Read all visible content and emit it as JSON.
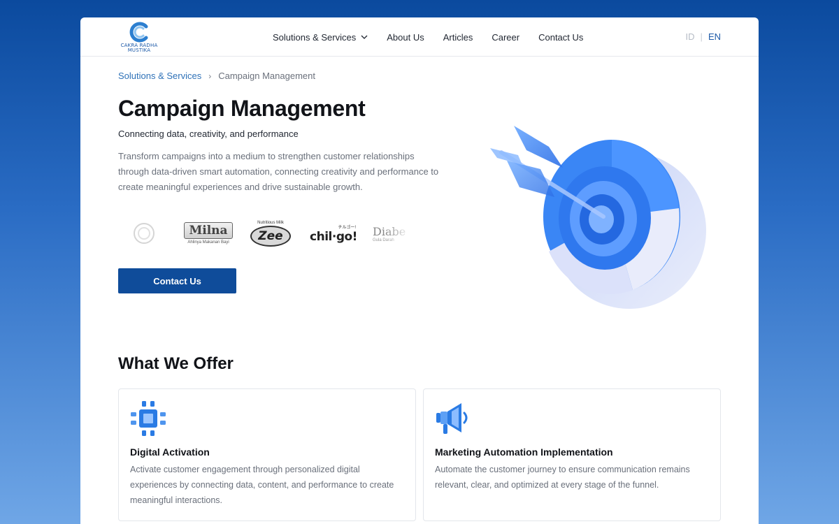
{
  "header": {
    "logo_text": "CAKRA RADHA MUSTIKA",
    "nav": [
      {
        "label": "Solutions & Services",
        "has_dropdown": true
      },
      {
        "label": "About Us"
      },
      {
        "label": "Articles"
      },
      {
        "label": "Career"
      },
      {
        "label": "Contact Us"
      }
    ],
    "lang": {
      "id": "ID",
      "separator": "|",
      "en": "EN",
      "active": "EN"
    }
  },
  "breadcrumb": {
    "parent": "Solutions & Services",
    "current": "Campaign Management"
  },
  "hero": {
    "title": "Campaign Management",
    "subtitle": "Connecting data, creativity, and performance",
    "description": "Transform campaigns into a medium to strengthen customer relationships through data-driven smart automation, connecting creativity and performance to create meaningful experiences and drive sustainable growth.",
    "brands": [
      {
        "name": "Milna",
        "tagline": "Ahlinya Makanan Bayi"
      },
      {
        "name": "Zee",
        "tagline": "Nutritious Milk"
      },
      {
        "name": "chil·go!",
        "tagline": "チルゴー!"
      },
      {
        "name": "Diabe",
        "tagline": "Gula Darah"
      }
    ],
    "cta_label": "Contact Us"
  },
  "offers": {
    "title": "What We Offer",
    "items": [
      {
        "icon": "chip-icon",
        "title": "Digital Activation",
        "text": "Activate customer engagement through personalized digital experiences by connecting data, content, and performance to create meaningful interactions."
      },
      {
        "icon": "megaphone-icon",
        "title": "Marketing Automation Implementation",
        "text": "Automate the customer journey to ensure communication remains relevant, clear, and optimized at every stage of the funnel."
      }
    ]
  },
  "colors": {
    "primary": "#0f4c9a",
    "link": "#2f72b8",
    "accent_icon": "#2a7be4"
  }
}
